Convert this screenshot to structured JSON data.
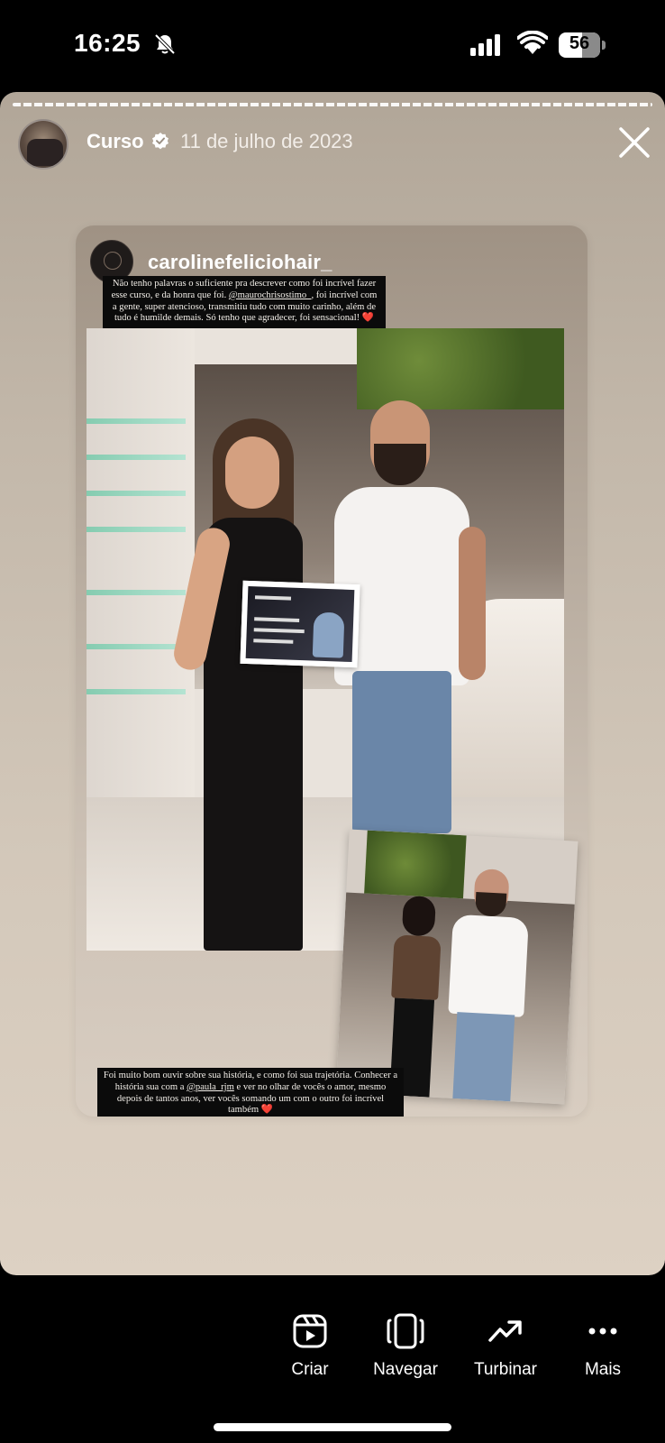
{
  "status_bar": {
    "time": "16:25",
    "battery": "56"
  },
  "story": {
    "username": "Curso",
    "date": "11 de julho de 2023",
    "reposted": {
      "username": "carolinefeliciohair_",
      "caption_top_1": "Não tenho palavras o suficiente pra descrever como foi incrível fazer esse curso, e da honra que foi.",
      "caption_top_mention": "@maurochrisostimo_",
      "caption_top_2": ", foi incrível com a gente, super atencioso, transmitiu tudo com muito carinho, além de tudo é humilde demais. Só tenho que agradecer, foi sensacional! ❤️",
      "caption_bottom_1": "Foi muito bom ouvir sobre sua história, e como foi sua trajetória. Conhecer a história sua com a",
      "caption_bottom_mention": "@paula_rjm",
      "caption_bottom_2": " e ver no olhar de vocês o amor, mesmo depois de tantos anos, ver vocês somando um com o outro foi incrível também ❤️"
    }
  },
  "actions": [
    {
      "label": "Criar",
      "icon": "reels-icon"
    },
    {
      "label": "Navegar",
      "icon": "phone-frame-icon"
    },
    {
      "label": "Turbinar",
      "icon": "trend-arrow-icon"
    },
    {
      "label": "Mais",
      "icon": "more-dots-icon"
    }
  ]
}
